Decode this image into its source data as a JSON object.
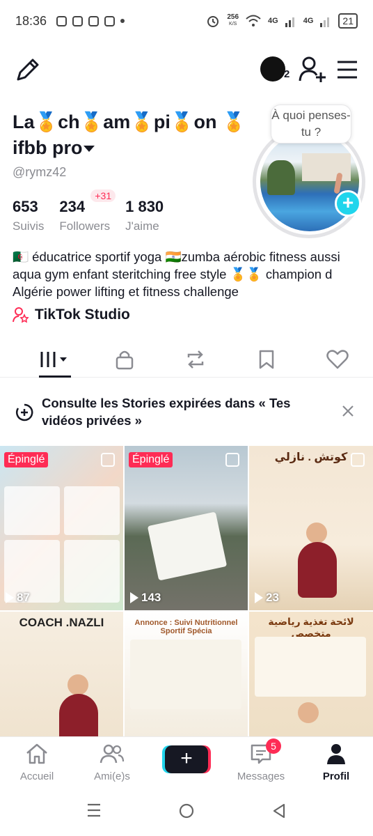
{
  "status_bar": {
    "time": "18:36",
    "net_speed_value": "256",
    "net_speed_unit": "K/S",
    "sig1": "4G",
    "sig2": "4G",
    "battery": "21"
  },
  "header": {
    "avatar_count": "2"
  },
  "profile": {
    "name": "La🏅ch🏅am🏅pi🏅on 🏅ifbb pro",
    "handle": "@rymz42",
    "thought_bubble": "À quoi penses-tu ?",
    "stats": [
      {
        "value": "653",
        "label": "Suivis"
      },
      {
        "value": "234",
        "label": "Followers",
        "badge": "+31"
      },
      {
        "value": "1 830",
        "label": "J'aime"
      }
    ],
    "bio": "🇩🇿 éducatrice sportif  yoga 🇮🇳zumba aérobic fitness aussi aqua gym enfant steritching free style 🏅🏅 champion d Algérie power lifting et  fitness challenge",
    "studio_label": "TikTok Studio"
  },
  "tabs": [
    "videos",
    "private",
    "reposts",
    "favorites",
    "liked"
  ],
  "banner": {
    "text": "Consulte les Stories expirées dans « Tes vidéos privées »"
  },
  "videos": [
    {
      "pinned": "Épinglé",
      "views": "87"
    },
    {
      "pinned": "Épinglé",
      "views": "143"
    },
    {
      "title": "كوتش . نازلي",
      "views": "23"
    },
    {
      "title": "COACH .NAZLI"
    },
    {
      "title": "Annonce : Suivi Nutritionnel Sportif Spécia"
    },
    {
      "title": "لائحة تغذية رياضية متخصص"
    }
  ],
  "bottom_nav": {
    "home": "Accueil",
    "friends": "Ami(e)s",
    "messages": "Messages",
    "messages_badge": "5",
    "profile": "Profil"
  },
  "colors": {
    "accent_red": "#fe2c55",
    "accent_cyan": "#20d5ec",
    "text_primary": "#161823",
    "text_secondary": "#8a8b91"
  }
}
